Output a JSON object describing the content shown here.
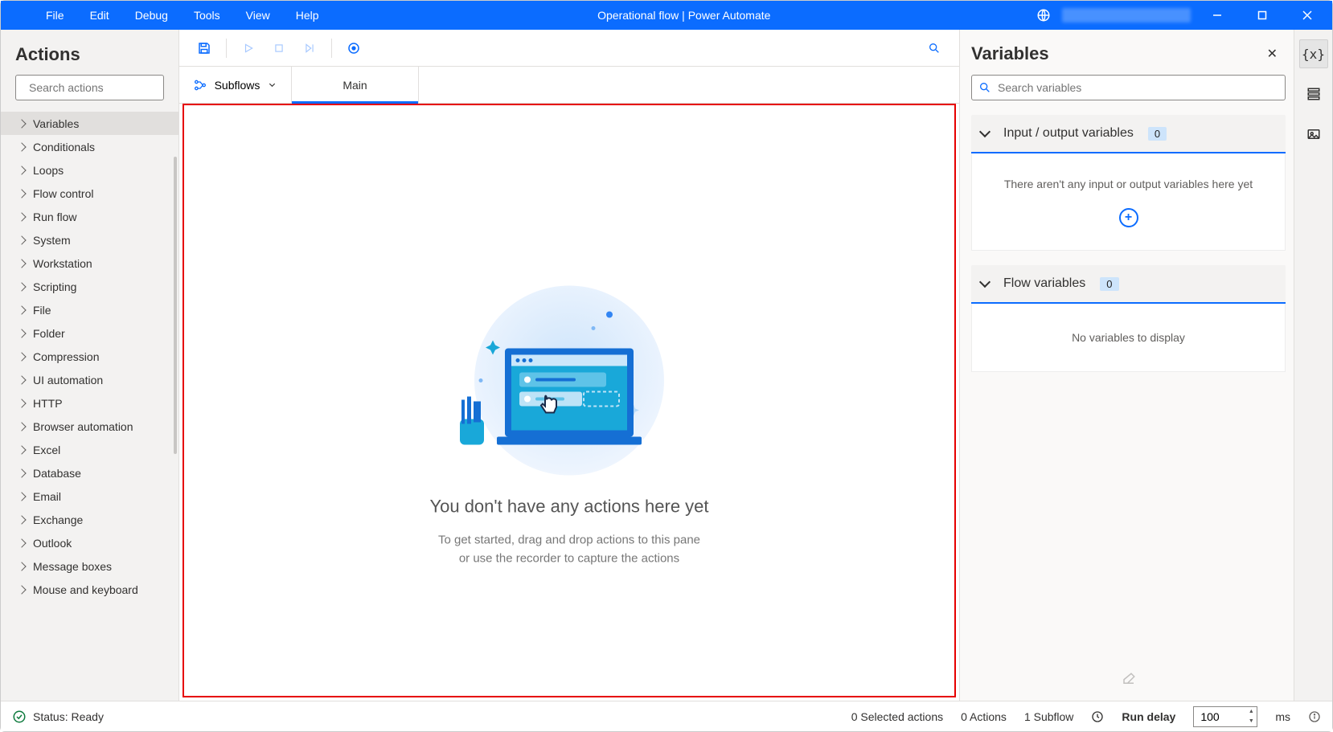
{
  "menu": [
    "File",
    "Edit",
    "Debug",
    "Tools",
    "View",
    "Help"
  ],
  "title": "Operational flow | Power Automate",
  "left": {
    "title": "Actions",
    "search_placeholder": "Search actions",
    "items": [
      "Variables",
      "Conditionals",
      "Loops",
      "Flow control",
      "Run flow",
      "System",
      "Workstation",
      "Scripting",
      "File",
      "Folder",
      "Compression",
      "UI automation",
      "HTTP",
      "Browser automation",
      "Excel",
      "Database",
      "Email",
      "Exchange",
      "Outlook",
      "Message boxes",
      "Mouse and keyboard"
    ]
  },
  "tabs": {
    "subflows": "Subflows",
    "main": "Main"
  },
  "empty": {
    "title": "You don't have any actions here yet",
    "line1": "To get started, drag and drop actions to this pane",
    "line2": "or use the recorder to capture the actions"
  },
  "right": {
    "title": "Variables",
    "search_placeholder": "Search variables",
    "io_title": "Input / output variables",
    "io_count": "0",
    "io_empty": "There aren't any input or output variables here yet",
    "flow_title": "Flow variables",
    "flow_count": "0",
    "flow_empty": "No variables to display"
  },
  "status": {
    "ready": "Status: Ready",
    "selected": "0 Selected actions",
    "actions": "0 Actions",
    "subflows": "1 Subflow",
    "run_delay": "Run delay",
    "delay_value": "100",
    "ms": "ms"
  }
}
